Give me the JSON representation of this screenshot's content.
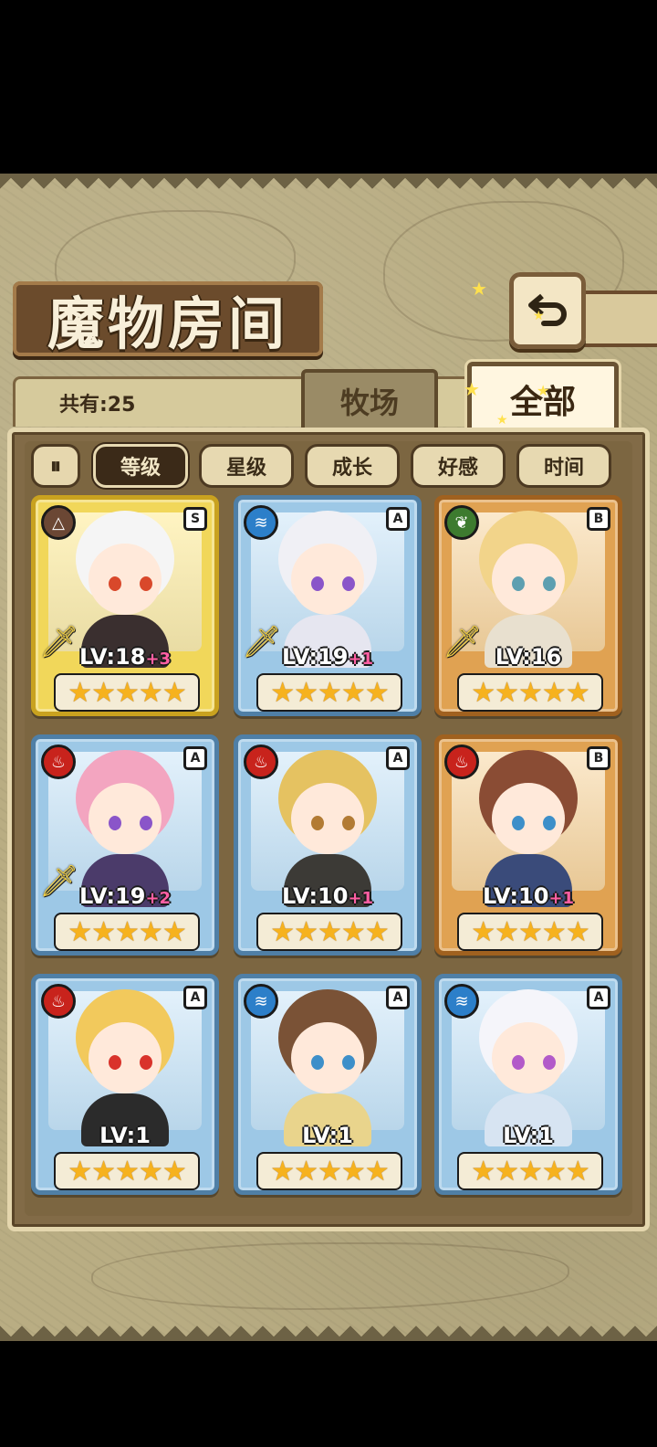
{
  "header": {
    "title": "魔物房间",
    "back_icon": "back-arrow-icon"
  },
  "summary": {
    "count": "共有:25"
  },
  "tabs": [
    {
      "label": "牧场",
      "active": false
    },
    {
      "label": "全部",
      "active": true
    }
  ],
  "sort": {
    "toggle_label": "⏸",
    "options": [
      {
        "label": "等级",
        "active": true
      },
      {
        "label": "星级",
        "active": false
      },
      {
        "label": "成长",
        "active": false
      },
      {
        "label": "好感",
        "active": false
      },
      {
        "label": "时间",
        "active": false
      }
    ]
  },
  "colors": {
    "gold": "#e4c23a",
    "blue": "#7cb4d8",
    "bronze": "#d28c3a"
  },
  "monsters": [
    {
      "level": "LV:18",
      "plus": "+3",
      "rank": "S",
      "element": "earth",
      "element_icon": "△",
      "frame": "gold",
      "equipped": true,
      "stars": "★★★★★"
    },
    {
      "level": "LV:19",
      "plus": "+1",
      "rank": "A",
      "element": "water",
      "element_icon": "≋",
      "frame": "blue",
      "equipped": true,
      "stars": "★★★★★"
    },
    {
      "level": "LV:16",
      "plus": "",
      "rank": "B",
      "element": "wood",
      "element_icon": "❦",
      "frame": "bronze",
      "equipped": true,
      "stars": "★★★★★"
    },
    {
      "level": "LV:19",
      "plus": "+2",
      "rank": "A",
      "element": "fire",
      "element_icon": "♨",
      "frame": "blue",
      "equipped": true,
      "stars": "★★★★★"
    },
    {
      "level": "LV:10",
      "plus": "+1",
      "rank": "A",
      "element": "fire",
      "element_icon": "♨",
      "frame": "blue",
      "equipped": false,
      "stars": "★★★★★"
    },
    {
      "level": "LV:10",
      "plus": "+1",
      "rank": "B",
      "element": "fire",
      "element_icon": "♨",
      "frame": "bronze",
      "equipped": false,
      "stars": "★★★★★"
    },
    {
      "level": "LV:1",
      "plus": "",
      "rank": "A",
      "element": "fire",
      "element_icon": "♨",
      "frame": "blue",
      "equipped": false,
      "stars": "★★★★★"
    },
    {
      "level": "LV:1",
      "plus": "",
      "rank": "A",
      "element": "water",
      "element_icon": "≋",
      "frame": "blue",
      "equipped": false,
      "stars": "★★★★★"
    },
    {
      "level": "LV:1",
      "plus": "",
      "rank": "A",
      "element": "water",
      "element_icon": "≋",
      "frame": "blue",
      "equipped": false,
      "stars": "★★★★★"
    }
  ]
}
